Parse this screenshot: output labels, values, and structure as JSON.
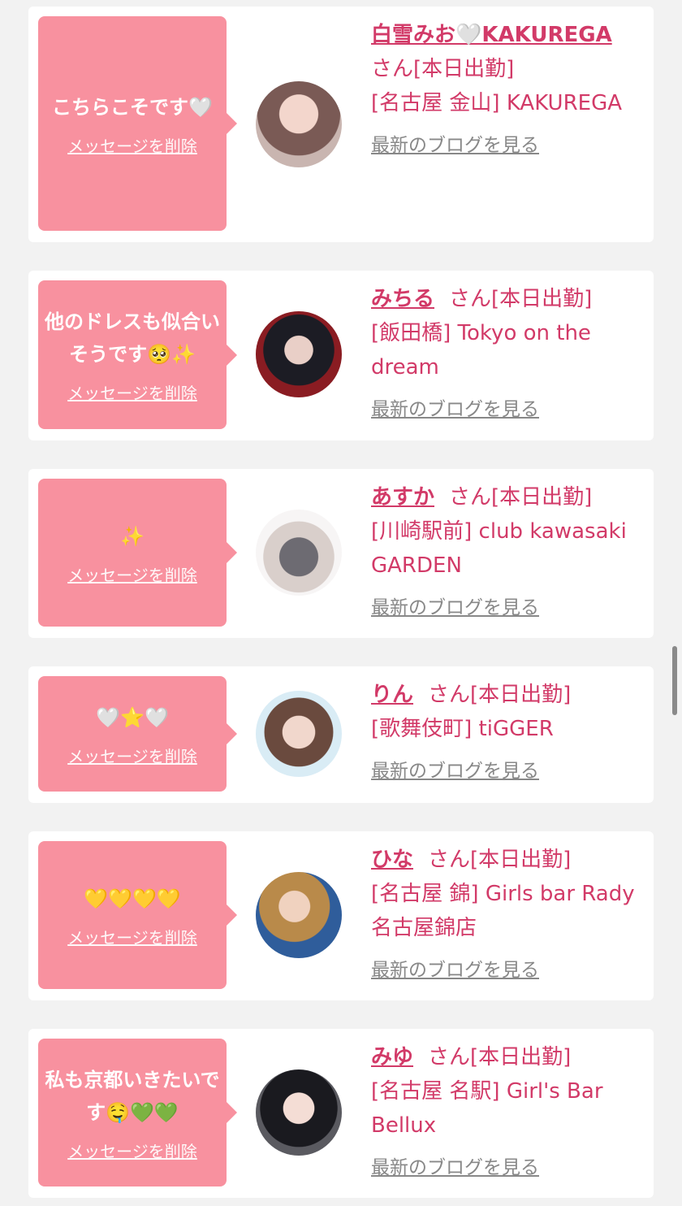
{
  "common": {
    "delete_label": "メッセージを削除",
    "blog_label": "最新のブログを見る",
    "bubble_color": "#f8919f",
    "accent_color": "#d23a68"
  },
  "cards": [
    {
      "message": "こちらこそです🤍",
      "name": "白雪みお🤍KAKUREGA",
      "suffix": "さん[本日出勤]",
      "shop": "[名古屋 金山] KAKUREGA",
      "avatar_icon": "woman-peace-sign-photo"
    },
    {
      "message": "他のドレスも似合いそうです🥺✨",
      "name": "みちる",
      "suffix": "さん[本日出勤]",
      "shop": "[飯田橋] Tokyo on the dream",
      "avatar_icon": "woman-bunny-ears-photo"
    },
    {
      "message": "✨",
      "name": "あすか",
      "suffix": "さん[本日出勤]",
      "shop": "[川崎駅前] club kawasaki GARDEN",
      "avatar_icon": "woman-grey-dress-photo"
    },
    {
      "message": "🤍⭐🤍",
      "name": "りん",
      "suffix": "さん[本日出勤]",
      "shop": "[歌舞伎町] tiGGER",
      "avatar_icon": "woman-selfie-photo"
    },
    {
      "message": "💛💛💛💛",
      "name": "ひな",
      "suffix": "さん[本日出勤]",
      "shop": "[名古屋 錦] Girls bar Rady 名古屋錦店",
      "avatar_icon": "woman-blonde-photo"
    },
    {
      "message": "私も京都いきたいです🤤💚💚",
      "name": "みゆ",
      "suffix": "さん[本日出勤]",
      "shop": "[名古屋 名駅] Girl's Bar Bellux",
      "avatar_icon": "woman-dark-hair-photo"
    }
  ]
}
